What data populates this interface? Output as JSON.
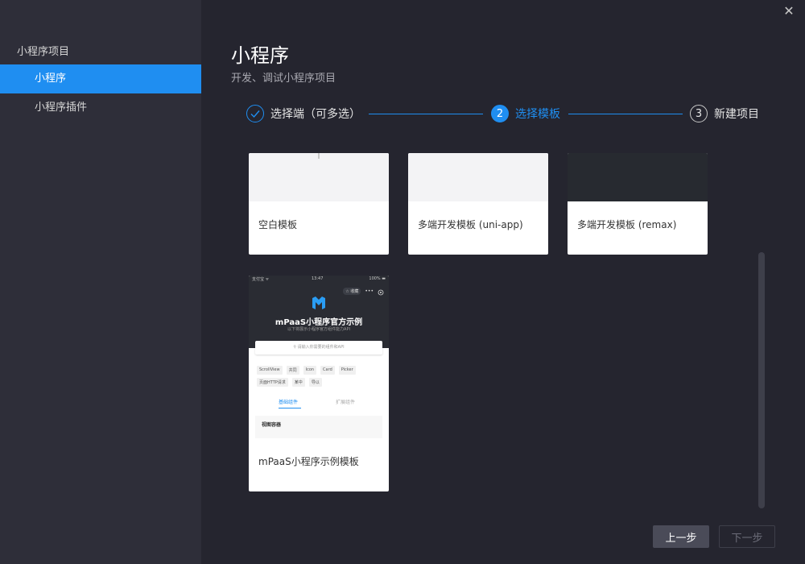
{
  "sidebar": {
    "group_title": "小程序项目",
    "items": [
      {
        "label": "小程序",
        "active": true
      },
      {
        "label": "小程序插件",
        "active": false
      }
    ]
  },
  "header": {
    "title": "小程序",
    "subtitle": "开发、调试小程序项目"
  },
  "steps": [
    {
      "number": "",
      "label": "选择端（可多选）",
      "state": "done"
    },
    {
      "number": "2",
      "label": "选择模板",
      "state": "current"
    },
    {
      "number": "3",
      "label": "新建项目",
      "state": "todo"
    }
  ],
  "templates": [
    {
      "label": "空白模板"
    },
    {
      "label": "多端开发模板 (uni-app)"
    },
    {
      "label": "多端开发模板 (remax)"
    },
    {
      "label": "mPaaS小程序示例模板"
    }
  ],
  "mpaas_preview": {
    "status_left": "支付宝 ᯤ",
    "status_time": "13:47",
    "status_right": "100% ▬",
    "pill": "☆ 收藏",
    "dots": "•••",
    "name": "mPaaS小程序官方示例",
    "subtitle": "以下将展示小程序官方组件能力API",
    "search_placeholder": "⚲ 请输入你需要的组件和API",
    "tags": [
      "ScrollView",
      "共同",
      "Icon",
      "Card",
      "Picker",
      "页面HTTP请求",
      "某中",
      "导以"
    ],
    "tab_basic": "基础组件",
    "tab_ext": "扩展组件",
    "section": "视图容器"
  },
  "footer": {
    "prev_label": "上一步",
    "next_label": "下一步"
  },
  "close_label": "✕",
  "colors": {
    "accent": "#1f8ef1",
    "sidebar_bg": "#2e2e39",
    "main_bg": "#25252f"
  }
}
